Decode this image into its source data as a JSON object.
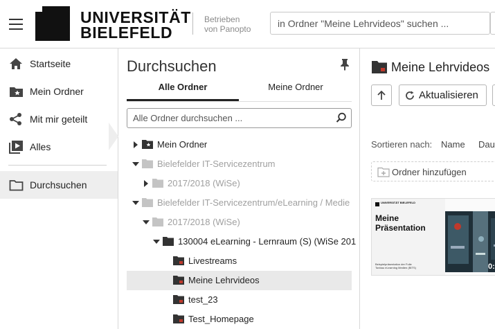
{
  "header": {
    "logo_line1": "UNIVERSITÄT",
    "logo_line2": "BIELEFELD",
    "powered_line1": "Betrieben",
    "powered_line2": "von Panopto",
    "search_placeholder": "in Ordner \"Meine Lehrvideos\" suchen ..."
  },
  "sidebar": {
    "items": [
      {
        "label": "Startseite",
        "icon": "home-icon"
      },
      {
        "label": "Mein Ordner",
        "icon": "folder-star-icon"
      },
      {
        "label": "Mit mir geteilt",
        "icon": "share-icon"
      },
      {
        "label": "Alles",
        "icon": "play-library-icon"
      },
      {
        "label": "Durchsuchen",
        "icon": "folder-outline-icon",
        "active": true
      }
    ]
  },
  "browse": {
    "title": "Durchsuchen",
    "tabs": [
      {
        "label": "Alle Ordner",
        "active": true
      },
      {
        "label": "Meine Ordner",
        "active": false
      }
    ],
    "search_placeholder": "Alle Ordner durchsuchen ...",
    "tree": [
      {
        "label": "Mein Ordner",
        "expanded": false,
        "dim": false,
        "icon": "folder-star-icon"
      },
      {
        "label": "Bielefelder IT-Servicezentrum",
        "expanded": true,
        "dim": true,
        "icon": "folder-icon"
      },
      {
        "label": "2017/2018 (WiSe)",
        "expanded": false,
        "dim": true,
        "icon": "folder-icon"
      },
      {
        "label": "Bielefelder IT-Servicezentrum/eLearning / Medie",
        "expanded": true,
        "dim": true,
        "icon": "folder-icon"
      },
      {
        "label": "2017/2018 (WiSe)",
        "expanded": true,
        "dim": true,
        "icon": "folder-icon"
      },
      {
        "label": "130004 eLearning - Lernraum (S) (WiSe 201",
        "expanded": true,
        "dim": false,
        "icon": "folder-icon"
      },
      {
        "label": "Livestreams",
        "dim": false,
        "icon": "folder-red-icon"
      },
      {
        "label": "Meine Lehrvideos",
        "dim": false,
        "icon": "folder-red-icon",
        "selected": true
      },
      {
        "label": "test_23",
        "dim": false,
        "icon": "folder-red-icon"
      },
      {
        "label": "Test_Homepage",
        "dim": false,
        "icon": "folder-red-icon"
      }
    ]
  },
  "content": {
    "title": "Meine Lehrvideos",
    "refresh_label": "Aktualisieren",
    "sort_label": "Sortieren nach:",
    "sort_name": "Name",
    "sort_duration": "Dau",
    "add_folder_label": "Ordner hinzufügen",
    "session": {
      "slide_title_line1": "Meine",
      "slide_title_line2": "Präsentation",
      "slide_logo_text": "UNIVERSITÄT BIELEFELD",
      "slide_subtitle": "Beispielpräsentation der Folie Tonbau eLearning Medien (BITS)",
      "duration": "0:"
    }
  },
  "colors": {
    "accent_red": "#c0392b",
    "folder_dark": "#333333",
    "folder_dim": "#c4c4c4",
    "active_bg": "#eeeeee"
  }
}
